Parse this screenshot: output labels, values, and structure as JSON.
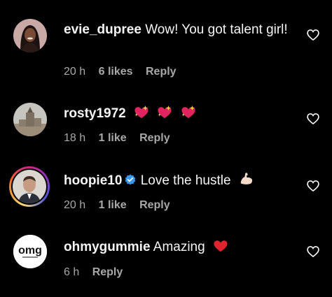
{
  "comments": [
    {
      "username": "evie_dupree",
      "text": "Wow! You got talent girl!",
      "time": "20 h",
      "likes": "6 likes",
      "reply": "Reply"
    },
    {
      "username": "rosty1972",
      "text": "",
      "time": "18 h",
      "likes": "1 like",
      "reply": "Reply",
      "emojis": [
        "sparkling-heart",
        "sparkling-heart",
        "sparkling-heart"
      ]
    },
    {
      "username": "hoopie10",
      "text": "Love the hustle",
      "time": "20 h",
      "likes": "1 like",
      "reply": "Reply",
      "verified": true,
      "emojis": [
        "flexed-biceps"
      ]
    },
    {
      "username": "ohmygummie",
      "text": "Amazing",
      "time": "6 h",
      "reply": "Reply",
      "emojis": [
        "red-heart"
      ]
    }
  ],
  "avatar_logo_text": "omg",
  "colors": {
    "background": "#000000",
    "text": "#f5f5f5",
    "meta": "#a8a8a8",
    "heart_emoji": "#e0245e",
    "verified": "#3897f0"
  }
}
